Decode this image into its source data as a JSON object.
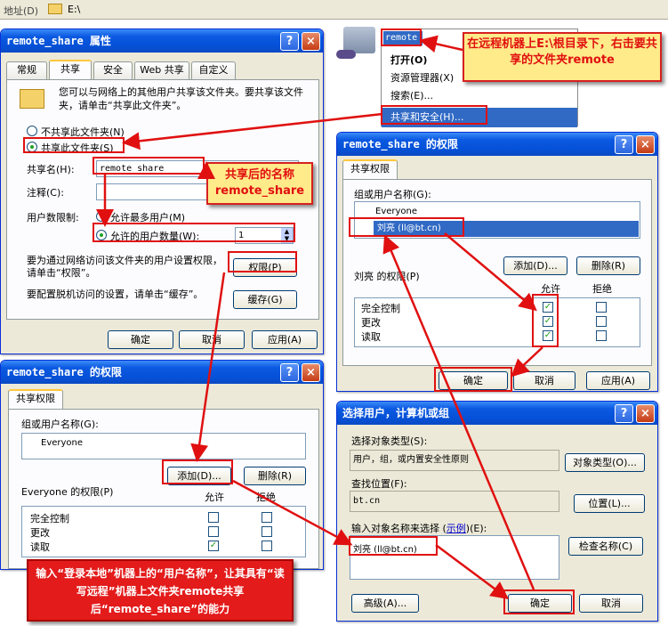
{
  "address_bar": {
    "label": "地址(D)",
    "path": "E:\\"
  },
  "context_menu": {
    "folder_name": "remote",
    "items": [
      "打开(O)",
      "资源管理器(X)",
      "搜索(E)...",
      "共享和安全(H)..."
    ]
  },
  "props_dialog": {
    "title": "remote_share 属性",
    "tabs": [
      "常规",
      "共享",
      "安全",
      "Web 共享",
      "自定义"
    ],
    "description": "您可以与网络上的其他用户共享该文件夹。要共享该文件夹，请单击“共享此文件夹”。",
    "radio_no_share": "不共享此文件夹(N)",
    "radio_share": "共享此文件夹(S)",
    "share_name_label": "共享名(H):",
    "share_name_value": "remote_share",
    "comment_label": "注释(C):",
    "user_limit_label": "用户数限制:",
    "radio_max": "允许最多用户(M)",
    "radio_allow": "允许的用户数量(W):",
    "user_count": "1",
    "perm_text": "要为通过网络访问该文件夹的用户设置权限，请单击“权限”。",
    "perm_button": "权限(P)",
    "cache_text": "要配置脱机访问的设置，请单击“缓存”。",
    "cache_button": "缓存(G)",
    "ok": "确定",
    "cancel": "取消",
    "apply": "应用(A)"
  },
  "perm_dialog_top": {
    "title": "remote_share 的权限",
    "tab": "共享权限",
    "group_label": "组或用户名称(G):",
    "users": [
      "Everyone",
      "刘亮 (ll@bt.cn)"
    ],
    "add": "添加(D)...",
    "remove": "删除(R)",
    "perm_for": "刘亮 的权限(P)",
    "allow": "允许",
    "deny": "拒绝",
    "permissions": [
      "完全控制",
      "更改",
      "读取"
    ],
    "allow_checked": [
      true,
      true,
      true
    ],
    "deny_checked": [
      false,
      false,
      false
    ],
    "ok": "确定",
    "cancel": "取消",
    "apply": "应用(A)"
  },
  "perm_dialog_bottom": {
    "title": "remote_share 的权限",
    "tab": "共享权限",
    "group_label": "组或用户名称(G):",
    "users": [
      "Everyone"
    ],
    "add": "添加(D)...",
    "remove": "删除(R)",
    "perm_for": "Everyone 的权限(P)",
    "allow": "允许",
    "deny": "拒绝",
    "permissions": [
      "完全控制",
      "更改",
      "读取"
    ],
    "allow_checked": [
      false,
      false,
      true
    ],
    "deny_checked": [
      false,
      false,
      false
    ]
  },
  "select_dialog": {
    "title": "选择用户，计算机或组",
    "type_label": "选择对象类型(S):",
    "type_value": "用户，组，或内置安全性原则",
    "type_button": "对象类型(O)...",
    "location_label": "查找位置(F):",
    "location_value": "bt.cn",
    "location_button": "位置(L)...",
    "input_label": "输入对象名称来选择",
    "input_link": "示例",
    "input_label_end": "(E):",
    "input_value": "刘亮 (ll@bt.cn)",
    "check_button": "检查名称(C)",
    "advanced": "高级(A)...",
    "ok": "确定",
    "cancel": "取消"
  },
  "annotations": {
    "a1": "在远程机器上E:\\根目录下，右击要共享的文件夹remote",
    "a2": "共享后的名称 remote_share",
    "a3": "输入“登录本地”机器上的“用户名称”，让其具有“读写远程”机器上文件夹remote共享后“remote_share”的能力"
  },
  "colors": {
    "accent_red": "#e01010",
    "title_blue": "#0551d8",
    "note_yellow": "#ffeb8a",
    "window_face": "#ece9d8"
  }
}
